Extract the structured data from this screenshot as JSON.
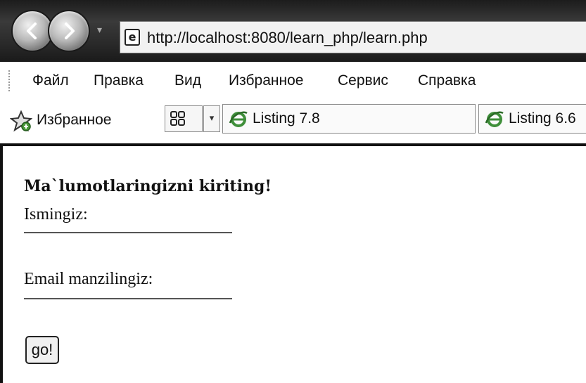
{
  "browser": {
    "address_url": "http://localhost:8080/learn_php/learn.php",
    "page_icon_glyph": "e",
    "nav_dropdown_glyph": "▾",
    "menu": [
      "Файл",
      "Правка",
      "Вид",
      "Избранное",
      "Сервис",
      "Справка"
    ],
    "favorites_label": "Избранное",
    "tab_dropdown_glyph": "▾",
    "tabs": [
      {
        "label": "Listing 7.8",
        "icon": "ie-icon"
      },
      {
        "label": "Listing 6.6",
        "icon": "ie-icon"
      }
    ]
  },
  "form": {
    "heading": "Ma`lumotlaringizni kiriting!",
    "name_label": "Ismingiz:",
    "name_value": "",
    "email_label": "Email manzilingiz:",
    "email_value": "",
    "submit_label": "go!"
  },
  "colors": {
    "chrome_dark": "#2a2a2a",
    "page_border": "#111111",
    "ie_icon_green": "#3f8f3a"
  }
}
